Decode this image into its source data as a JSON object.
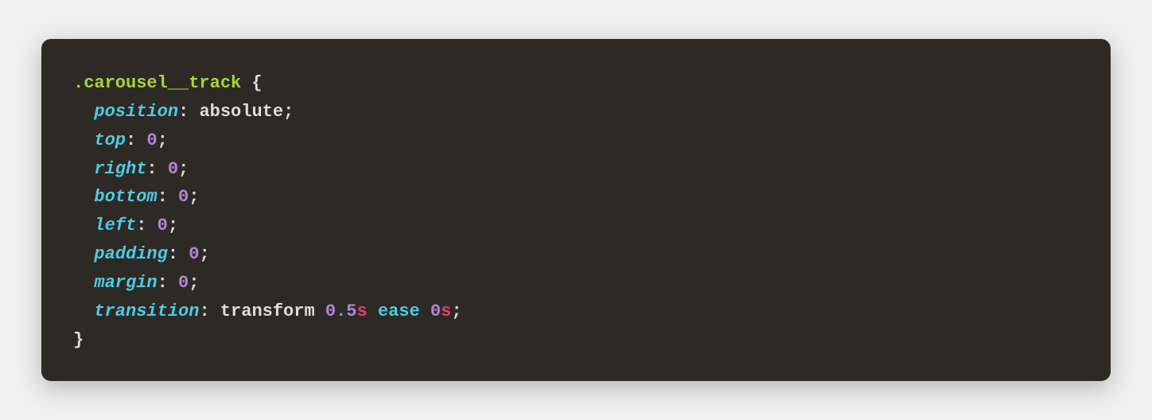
{
  "code": {
    "selector": ".carousel__track",
    "brace_open": " {",
    "brace_close": "}",
    "indent": "  ",
    "lines": [
      {
        "property": "position",
        "colon": ": ",
        "value": "absolute",
        "semi": ";"
      },
      {
        "property": "top",
        "colon": ": ",
        "number": "0",
        "semi": ";"
      },
      {
        "property": "right",
        "colon": ": ",
        "number": "0",
        "semi": ";"
      },
      {
        "property": "bottom",
        "colon": ": ",
        "number": "0",
        "semi": ";"
      },
      {
        "property": "left",
        "colon": ": ",
        "number": "0",
        "semi": ";"
      },
      {
        "property": "padding",
        "colon": ": ",
        "number": "0",
        "semi": ";"
      },
      {
        "property": "margin",
        "colon": ": ",
        "number": "0",
        "semi": ";"
      },
      {
        "property": "transition",
        "colon": ": ",
        "value1": "transform ",
        "num1": "0.5",
        "unit1": "s",
        "sp1": " ",
        "ease": "ease",
        "sp2": " ",
        "num2": "0",
        "unit2": "s",
        "semi": ";"
      }
    ]
  }
}
